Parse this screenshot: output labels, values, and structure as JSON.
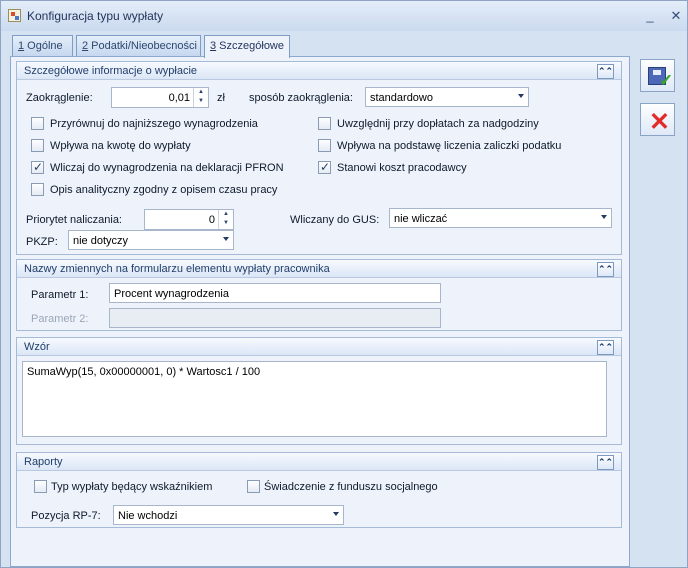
{
  "window": {
    "title": "Konfiguracja typu wypłaty",
    "minimize": "_",
    "close": "✕"
  },
  "tabs": [
    {
      "number": "1",
      "label": " Ogólne"
    },
    {
      "number": "2",
      "label": " Podatki/Nieobecności"
    },
    {
      "number": "3",
      "label": " Szczegółowe"
    }
  ],
  "details": {
    "title": "Szczegółowe informacje o wypłacie",
    "rounding_label": "Zaokrąglenie:",
    "rounding_value": "0,01",
    "currency": "zł",
    "rounding_method_label": "sposób zaokrąglenia:",
    "rounding_method_value": "standardowo",
    "checkboxes": [
      {
        "label": "Przyrównuj do najniższego wynagrodzenia",
        "checked": false
      },
      {
        "label": "Uwzględnij przy dopłatach za nadgodziny",
        "checked": false
      },
      {
        "label": "Wpływa na kwotę do wypłaty",
        "checked": false
      },
      {
        "label": "Wpływa na podstawę liczenia zaliczki podatku",
        "checked": false
      },
      {
        "label": "Wliczaj do wynagrodzenia na deklaracji PFRON",
        "checked": true
      },
      {
        "label": "Stanowi koszt pracodawcy",
        "checked": true
      },
      {
        "label": "Opis analityczny zgodny z opisem czasu pracy",
        "checked": false
      }
    ],
    "priority_label": "Priorytet naliczania:",
    "priority_value": "0",
    "gus_label": "Wliczany do GUS:",
    "gus_value": "nie wliczać",
    "pkzp_label": "PKZP:",
    "pkzp_value": "nie dotyczy"
  },
  "variables": {
    "title": "Nazwy zmiennych na formularzu elementu wypłaty pracownika",
    "param1_label": "Parametr 1:",
    "param1_value": "Procent wynagrodzenia",
    "param2_label": "Parametr 2:",
    "param2_value": ""
  },
  "formula": {
    "title": "Wzór",
    "value": "SumaWyp(15, 0x00000001, 0) * Wartosc1 / 100"
  },
  "reports": {
    "title": "Raporty",
    "indicator_label": "Typ wypłaty będący wskaźnikiem",
    "social_fund_label": "Świadczenie z funduszu socjalnego",
    "rp7_label": "Pozycja RP-7:",
    "rp7_value": "Nie wchodzi"
  },
  "colors": {
    "accent": "#4b79c7",
    "cancel": "#e22b2b",
    "save_check": "#3ba42a"
  },
  "icons": {
    "save": "save-icon",
    "cancel": "cancel-icon",
    "collapse": "collapse-up-icon"
  }
}
